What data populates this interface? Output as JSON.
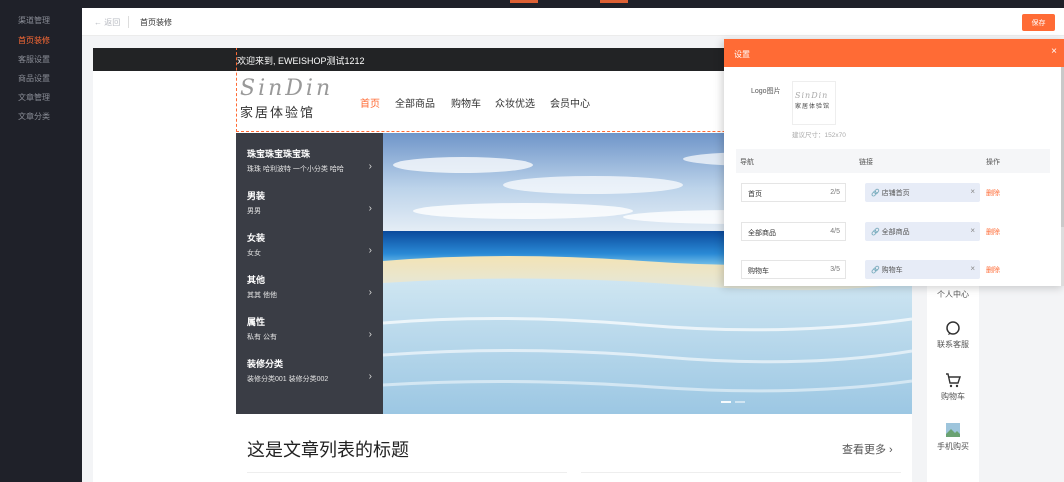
{
  "sidebar": {
    "items": [
      {
        "label": "渠道管理",
        "active": false
      },
      {
        "label": "首页装修",
        "active": true
      },
      {
        "label": "客服设置",
        "active": false
      },
      {
        "label": "商品设置",
        "active": false
      },
      {
        "label": "文章管理",
        "active": false
      },
      {
        "label": "文章分类",
        "active": false
      }
    ]
  },
  "topbar": {
    "back_label": "← 返回",
    "breadcrumb": "首页装修",
    "save_label": "保存"
  },
  "store": {
    "welcome": "欢迎来到, EWEISHOP测试1212",
    "logo_en": "SinDin",
    "logo_cn": "家居体验馆",
    "nav": [
      "首页",
      "全部商品",
      "购物车",
      "众妆优选",
      "会员中心"
    ],
    "categories": [
      {
        "title": "珠宝珠宝珠宝珠",
        "sub": "珠珠   哈利波特   一个小分类   哈哈"
      },
      {
        "title": "男装",
        "sub": "男男"
      },
      {
        "title": "女装",
        "sub": "女女"
      },
      {
        "title": "其他",
        "sub": "其其   他他"
      },
      {
        "title": "属性",
        "sub": "私有   公有"
      },
      {
        "title": "装修分类",
        "sub": "装修分类001   装修分类002"
      }
    ],
    "article_title": "这是文章列表的标题",
    "view_more": "查看更多 ›"
  },
  "side_tools": [
    {
      "label": "个人中心",
      "icon": "user-icon"
    },
    {
      "label": "联系客服",
      "icon": "chat-icon"
    },
    {
      "label": "购物车",
      "icon": "cart-icon"
    },
    {
      "label": "手机购买",
      "icon": "image-icon"
    }
  ],
  "settings_panel": {
    "title": "设置",
    "close": "×",
    "logo_label": "Logo图片",
    "logo_hint": "建议尺寸：152x70",
    "columns": {
      "nav": "导航",
      "link": "链接",
      "action": "操作"
    },
    "rows": [
      {
        "label": "首页",
        "count": "2/5",
        "link": "店铺首页",
        "action": "删除"
      },
      {
        "label": "全部商品",
        "count": "4/5",
        "link": "全部商品",
        "action": "删除"
      },
      {
        "label": "购物车",
        "count": "3/5",
        "link": "购物车",
        "action": "删除"
      }
    ]
  },
  "colors": {
    "accent": "#ff6b35",
    "sidebar_bg": "#1f2129",
    "menu_bg": "#3a3d45"
  }
}
